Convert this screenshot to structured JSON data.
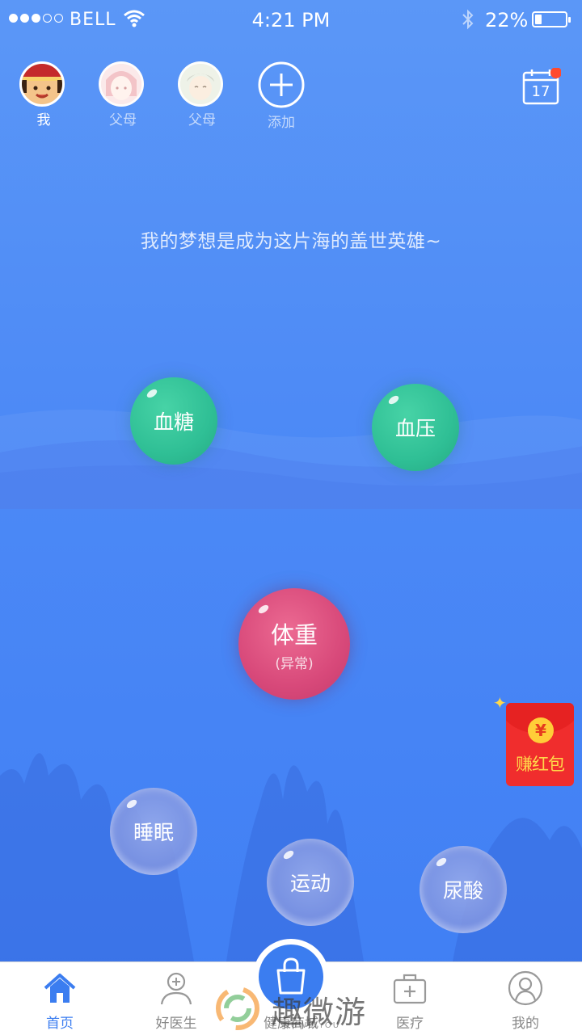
{
  "status_bar": {
    "carrier": "BELL",
    "time": "4:21 PM",
    "battery_percent": "22%",
    "battery_level": 0.22,
    "signal_strength": "3 of 5"
  },
  "profiles": [
    {
      "label": "我",
      "active": true
    },
    {
      "label": "父母",
      "active": false
    },
    {
      "label": "父母",
      "active": false
    },
    {
      "label": "添加",
      "active": false
    }
  ],
  "calendar": {
    "day": "17",
    "has_notification": true,
    "icon": "calendar-icon"
  },
  "motto": "我的梦想是成为这片海的盖世英雄~",
  "bubbles": {
    "blood_sugar": {
      "label": "血糖",
      "color": "#2fbf95"
    },
    "blood_pressure": {
      "label": "血压",
      "color": "#2fbf95"
    },
    "weight": {
      "label": "体重",
      "status": "(异常)",
      "color": "#d8497a"
    },
    "sleep": {
      "label": "睡眠"
    },
    "exercise": {
      "label": "运动"
    },
    "uric_acid": {
      "label": "尿酸"
    }
  },
  "red_packet": {
    "label": "赚红包",
    "coin": "¥",
    "color": "#f02d2d"
  },
  "tab_bar": {
    "tabs": [
      {
        "label": "首页",
        "icon": "home-icon",
        "active": true
      },
      {
        "label": "好医生",
        "icon": "doctor-icon",
        "active": false
      },
      {
        "label": "健康商城",
        "icon": "shopping-bag-icon",
        "active": false
      },
      {
        "label": "医疗",
        "icon": "medical-kit-icon",
        "active": false
      },
      {
        "label": "我的",
        "icon": "user-icon",
        "active": false
      }
    ],
    "active_color": "#3b7df0"
  },
  "watermark": {
    "text": "趣微游",
    "sub": "QUWEIYOU"
  }
}
